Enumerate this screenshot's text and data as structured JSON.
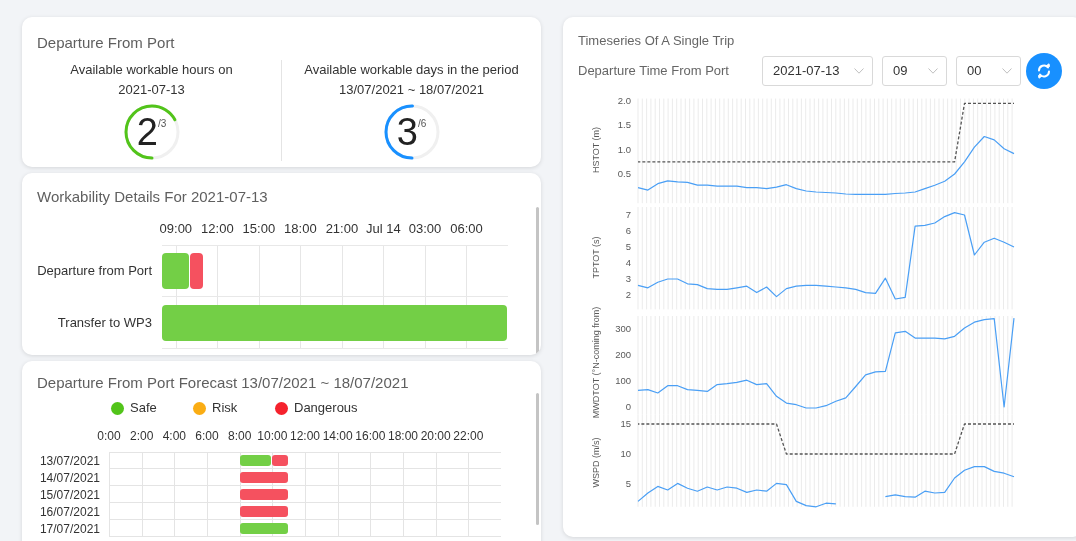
{
  "departure": {
    "title": "Departure From Port",
    "stats": [
      {
        "caption": "Available workable hours on",
        "subcaption": "2021-07-13",
        "value": "2",
        "total": "/3",
        "color": "#52c41a"
      },
      {
        "caption": "Available workable days in the period",
        "subcaption": "13/07/2021 ~ 18/07/2021",
        "value": "3",
        "total": "/6",
        "color": "#1890ff"
      }
    ]
  },
  "workability": {
    "title": "Workability Details For 2021-07-13",
    "ticks": [
      "09:00",
      "12:00",
      "15:00",
      "18:00",
      "21:00",
      "Jul 14",
      "03:00",
      "06:00"
    ],
    "rows": [
      {
        "label": "Departure from Port",
        "cells": [
          {
            "kind": "safe"
          },
          {
            "kind": "safe"
          },
          {
            "kind": "dangerous"
          },
          {
            "kind": "empty"
          },
          {
            "kind": "empty"
          },
          {
            "kind": "empty"
          },
          {
            "kind": "empty"
          },
          {
            "kind": "empty"
          },
          {
            "kind": "empty"
          },
          {
            "kind": "empty"
          },
          {
            "kind": "empty"
          },
          {
            "kind": "empty"
          },
          {
            "kind": "empty"
          },
          {
            "kind": "empty"
          },
          {
            "kind": "empty"
          },
          {
            "kind": "empty"
          },
          {
            "kind": "empty"
          },
          {
            "kind": "empty"
          },
          {
            "kind": "empty"
          },
          {
            "kind": "empty"
          },
          {
            "kind": "empty"
          },
          {
            "kind": "empty"
          },
          {
            "kind": "empty"
          },
          {
            "kind": "empty"
          },
          {
            "kind": "empty"
          }
        ]
      },
      {
        "label": "Transfer to WP3",
        "cells": [
          {
            "kind": "safe"
          },
          {
            "kind": "safe"
          },
          {
            "kind": "safe"
          },
          {
            "kind": "safe"
          },
          {
            "kind": "safe"
          },
          {
            "kind": "safe"
          },
          {
            "kind": "safe"
          },
          {
            "kind": "safe"
          },
          {
            "kind": "safe"
          },
          {
            "kind": "safe"
          },
          {
            "kind": "safe"
          },
          {
            "kind": "safe"
          },
          {
            "kind": "safe"
          },
          {
            "kind": "safe"
          },
          {
            "kind": "safe"
          },
          {
            "kind": "safe"
          },
          {
            "kind": "safe"
          },
          {
            "kind": "safe"
          },
          {
            "kind": "safe"
          },
          {
            "kind": "safe"
          },
          {
            "kind": "safe"
          },
          {
            "kind": "safe"
          },
          {
            "kind": "safe"
          },
          {
            "kind": "safe"
          },
          {
            "kind": "safe"
          }
        ]
      }
    ]
  },
  "forecast": {
    "title": "Departure From Port Forecast 13/07/2021 ~ 18/07/2021",
    "legend": [
      {
        "label": "Safe",
        "color": "#52c41a"
      },
      {
        "label": "Risk",
        "color": "#faad14"
      },
      {
        "label": "Dangerous",
        "color": "#f5222d"
      }
    ],
    "hours": [
      "0:00",
      "2:00",
      "4:00",
      "6:00",
      "8:00",
      "10:00",
      "12:00",
      "14:00",
      "16:00",
      "18:00",
      "20:00",
      "22:00"
    ],
    "rows": [
      {
        "date": "13/07/2021",
        "cells": [
          {
            "kind": "empty"
          },
          {
            "kind": "empty"
          },
          {
            "kind": "empty"
          },
          {
            "kind": "empty"
          },
          {
            "kind": "empty"
          },
          {
            "kind": "empty"
          },
          {
            "kind": "empty"
          },
          {
            "kind": "empty"
          },
          {
            "kind": "safe"
          },
          {
            "kind": "safe"
          },
          {
            "kind": "dangerous"
          },
          {
            "kind": "empty"
          },
          {
            "kind": "empty"
          },
          {
            "kind": "empty"
          },
          {
            "kind": "empty"
          },
          {
            "kind": "empty"
          },
          {
            "kind": "empty"
          },
          {
            "kind": "empty"
          },
          {
            "kind": "empty"
          },
          {
            "kind": "empty"
          },
          {
            "kind": "empty"
          },
          {
            "kind": "empty"
          },
          {
            "kind": "empty"
          },
          {
            "kind": "empty"
          }
        ]
      },
      {
        "date": "14/07/2021",
        "cells": [
          {
            "kind": "empty"
          },
          {
            "kind": "empty"
          },
          {
            "kind": "empty"
          },
          {
            "kind": "empty"
          },
          {
            "kind": "empty"
          },
          {
            "kind": "empty"
          },
          {
            "kind": "empty"
          },
          {
            "kind": "empty"
          },
          {
            "kind": "dangerous"
          },
          {
            "kind": "dangerous"
          },
          {
            "kind": "dangerous"
          },
          {
            "kind": "empty"
          },
          {
            "kind": "empty"
          },
          {
            "kind": "empty"
          },
          {
            "kind": "empty"
          },
          {
            "kind": "empty"
          },
          {
            "kind": "empty"
          },
          {
            "kind": "empty"
          },
          {
            "kind": "empty"
          },
          {
            "kind": "empty"
          },
          {
            "kind": "empty"
          },
          {
            "kind": "empty"
          },
          {
            "kind": "empty"
          },
          {
            "kind": "empty"
          }
        ]
      },
      {
        "date": "15/07/2021",
        "cells": [
          {
            "kind": "empty"
          },
          {
            "kind": "empty"
          },
          {
            "kind": "empty"
          },
          {
            "kind": "empty"
          },
          {
            "kind": "empty"
          },
          {
            "kind": "empty"
          },
          {
            "kind": "empty"
          },
          {
            "kind": "empty"
          },
          {
            "kind": "dangerous"
          },
          {
            "kind": "dangerous"
          },
          {
            "kind": "dangerous"
          },
          {
            "kind": "empty"
          },
          {
            "kind": "empty"
          },
          {
            "kind": "empty"
          },
          {
            "kind": "empty"
          },
          {
            "kind": "empty"
          },
          {
            "kind": "empty"
          },
          {
            "kind": "empty"
          },
          {
            "kind": "empty"
          },
          {
            "kind": "empty"
          },
          {
            "kind": "empty"
          },
          {
            "kind": "empty"
          },
          {
            "kind": "empty"
          },
          {
            "kind": "empty"
          }
        ]
      },
      {
        "date": "16/07/2021",
        "cells": [
          {
            "kind": "empty"
          },
          {
            "kind": "empty"
          },
          {
            "kind": "empty"
          },
          {
            "kind": "empty"
          },
          {
            "kind": "empty"
          },
          {
            "kind": "empty"
          },
          {
            "kind": "empty"
          },
          {
            "kind": "empty"
          },
          {
            "kind": "dangerous"
          },
          {
            "kind": "dangerous"
          },
          {
            "kind": "dangerous"
          },
          {
            "kind": "empty"
          },
          {
            "kind": "empty"
          },
          {
            "kind": "empty"
          },
          {
            "kind": "empty"
          },
          {
            "kind": "empty"
          },
          {
            "kind": "empty"
          },
          {
            "kind": "empty"
          },
          {
            "kind": "empty"
          },
          {
            "kind": "empty"
          },
          {
            "kind": "empty"
          },
          {
            "kind": "empty"
          },
          {
            "kind": "empty"
          },
          {
            "kind": "empty"
          }
        ]
      },
      {
        "date": "17/07/2021",
        "cells": [
          {
            "kind": "empty"
          },
          {
            "kind": "empty"
          },
          {
            "kind": "empty"
          },
          {
            "kind": "empty"
          },
          {
            "kind": "empty"
          },
          {
            "kind": "empty"
          },
          {
            "kind": "empty"
          },
          {
            "kind": "empty"
          },
          {
            "kind": "safe"
          },
          {
            "kind": "safe"
          },
          {
            "kind": "safe"
          },
          {
            "kind": "empty"
          },
          {
            "kind": "empty"
          },
          {
            "kind": "empty"
          },
          {
            "kind": "empty"
          },
          {
            "kind": "empty"
          },
          {
            "kind": "empty"
          },
          {
            "kind": "empty"
          },
          {
            "kind": "empty"
          },
          {
            "kind": "empty"
          },
          {
            "kind": "empty"
          },
          {
            "kind": "empty"
          },
          {
            "kind": "empty"
          },
          {
            "kind": "empty"
          }
        ]
      }
    ]
  },
  "trip": {
    "title": "Timeseries Of A Single Trip",
    "departure_label": "Departure Time From Port",
    "selects": [
      {
        "value": "2021-07-13"
      },
      {
        "value": "09"
      },
      {
        "value": "00"
      }
    ],
    "charts": [
      {
        "chart_data": {
          "type": "line",
          "grid": true,
          "ylabel": "HSTOT (m)",
          "ylim": [
            -0.1,
            2.05
          ],
          "categories": [
            null,
            null,
            null,
            null,
            null,
            null,
            null,
            null,
            null,
            null,
            null,
            null,
            null,
            null,
            null,
            null,
            null,
            null,
            null,
            null,
            null,
            null,
            null,
            null,
            null,
            null,
            null,
            null,
            null,
            null,
            null,
            null,
            null,
            null,
            null,
            null,
            null,
            null,
            null
          ],
          "yticks": [
            {
              "value": 0.5,
              "label": "0.5"
            },
            {
              "value": 1,
              "label": "1.0"
            },
            {
              "value": 1.5,
              "label": "1.5"
            },
            {
              "value": 2,
              "label": "2.0"
            }
          ],
          "series": [
            {
              "color": "#4a9ff5",
              "values": [
                0.22,
                0.17,
                0.3,
                0.36,
                0.34,
                0.33,
                0.27,
                0.27,
                0.25,
                0.25,
                0.25,
                0.22,
                0.22,
                0.2,
                0.23,
                0.28,
                0.2,
                0.15,
                0.13,
                0.12,
                0.11,
                0.09,
                0.08,
                0.08,
                0.08,
                0.08,
                0.1,
                0.11,
                0.13,
                0.2,
                0.27,
                0.35,
                0.5,
                0.75,
                1.05,
                1.27,
                1.2,
                1.02,
                0.92
              ]
            },
            {
              "color": "#555555",
              "line_style": "dashed",
              "values": [
                0.75,
                0.75,
                0.75,
                0.75,
                0.75,
                0.75,
                0.75,
                0.75,
                0.75,
                0.75,
                0.75,
                0.75,
                0.75,
                0.75,
                0.75,
                0.75,
                0.75,
                0.75,
                0.75,
                0.75,
                0.75,
                0.75,
                0.75,
                0.75,
                0.75,
                0.75,
                0.75,
                0.75,
                0.75,
                0.75,
                0.75,
                0.75,
                0.75,
                1.95,
                1.95,
                1.95,
                1.95,
                1.95,
                1.95
              ]
            }
          ]
        }
      },
      {
        "chart_data": {
          "type": "line",
          "grid": true,
          "ylabel": "TPTOT (s)",
          "ylim": [
            1.1,
            7.5
          ],
          "categories": [
            null,
            null,
            null,
            null,
            null,
            null,
            null,
            null,
            null,
            null,
            null,
            null,
            null,
            null,
            null,
            null,
            null,
            null,
            null,
            null,
            null,
            null,
            null,
            null,
            null,
            null,
            null,
            null,
            null,
            null,
            null,
            null,
            null,
            null,
            null,
            null,
            null,
            null,
            null
          ],
          "yticks": [
            {
              "value": 2,
              "label": "2"
            },
            {
              "value": 3,
              "label": "3"
            },
            {
              "value": 4,
              "label": "4"
            },
            {
              "value": 5,
              "label": "5"
            },
            {
              "value": 6,
              "label": "6"
            },
            {
              "value": 7,
              "label": "7"
            }
          ],
          "series": [
            {
              "color": "#4a9ff5",
              "values": [
                2.6,
                2.45,
                2.8,
                3.0,
                3.0,
                2.7,
                2.65,
                2.4,
                2.35,
                2.35,
                2.45,
                2.55,
                2.15,
                2.5,
                1.9,
                2.4,
                2.55,
                2.6,
                2.6,
                2.55,
                2.5,
                2.45,
                2.35,
                2.15,
                2.1,
                3.05,
                1.75,
                1.85,
                6.3,
                6.35,
                6.5,
                6.9,
                7.15,
                7.0,
                4.5,
                5.3,
                5.55,
                5.3,
                5.0
              ]
            }
          ]
        }
      },
      {
        "chart_data": {
          "type": "line",
          "grid": true,
          "ylabel": "MWDTOT (°N-coming from)",
          "ylim": [
            -30,
            350
          ],
          "categories": [
            null,
            null,
            null,
            null,
            null,
            null,
            null,
            null,
            null,
            null,
            null,
            null,
            null,
            null,
            null,
            null,
            null,
            null,
            null,
            null,
            null,
            null,
            null,
            null,
            null,
            null,
            null,
            null,
            null,
            null,
            null,
            null,
            null,
            null,
            null,
            null,
            null,
            null,
            null
          ],
          "yticks": [
            {
              "value": 0,
              "label": "0"
            },
            {
              "value": 100,
              "label": "100"
            },
            {
              "value": 200,
              "label": "200"
            },
            {
              "value": 300,
              "label": "300"
            }
          ],
          "series": [
            {
              "color": "#4a9ff5",
              "values": [
                64,
                67,
                54,
                82,
                82,
                67,
                64,
                60,
                86,
                90,
                95,
                103,
                86,
                90,
                41,
                15,
                9,
                -4,
                -4,
                5,
                22,
                35,
                79,
                124,
                135,
                137,
                285,
                291,
                265,
                265,
                265,
                262,
                272,
                304,
                326,
                336,
                340,
                0,
                342
              ]
            }
          ]
        }
      },
      {
        "chart_data": {
          "type": "line",
          "grid": true,
          "ylabel": "WSPD (m/s)",
          "ylim": [
            1.2,
            16.5
          ],
          "categories": [
            null,
            null,
            null,
            null,
            null,
            null,
            null,
            null,
            null,
            null,
            null,
            null,
            null,
            null,
            null,
            null,
            null,
            null,
            null,
            null,
            null,
            null,
            null,
            null,
            null,
            null,
            null,
            null,
            null,
            null,
            null,
            null,
            null,
            null,
            null,
            null,
            null,
            null,
            null
          ],
          "yticks": [
            {
              "value": 5,
              "label": "5"
            },
            {
              "value": 10,
              "label": "10"
            },
            {
              "value": 15,
              "label": "15"
            }
          ],
          "series": [
            {
              "color": "#4a9ff5",
              "values": [
                2.1,
                3.5,
                4.6,
                4.0,
                5.1,
                4.3,
                3.8,
                4.5,
                4.0,
                4.5,
                4.3,
                3.6,
                4.0,
                3.8,
                5.1,
                4.9,
                2.1,
                1.4,
                1.2,
                1.8,
                1.7,
                null,
                null,
                null,
                null,
                2.9,
                3.2,
                2.9,
                2.8,
                3.8,
                3.5,
                3.6,
                6.0,
                7.3,
                7.9,
                7.9,
                7.1,
                6.8,
                6.2
              ]
            },
            {
              "color": "#555555",
              "line_style": "dashed",
              "values": [
                15,
                15,
                15,
                15,
                15,
                15,
                15,
                15,
                15,
                15,
                15,
                15,
                15,
                15,
                15,
                10,
                10,
                10,
                10,
                10,
                10,
                10,
                10,
                10,
                10,
                10,
                10,
                10,
                10,
                10,
                10,
                10,
                10,
                15,
                15,
                15,
                15,
                15,
                15
              ]
            }
          ]
        }
      }
    ]
  }
}
